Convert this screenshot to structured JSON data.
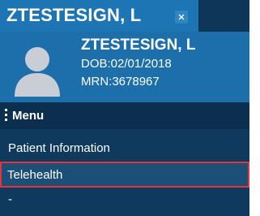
{
  "tab": {
    "title": "ZTESTESIGN, L",
    "close_icon": "close-icon"
  },
  "patient": {
    "name": "ZTESTESIGN, L",
    "dob": "DOB:02/01/2018",
    "mrn": "MRN:3678967",
    "avatar_icon": "person-silhouette-icon"
  },
  "menu": {
    "label": "Menu",
    "icon": "vertical-dots-icon",
    "items": [
      {
        "label": "Patient Information"
      },
      {
        "label": "Telehealth",
        "highlighted": true
      },
      {
        "label": "-"
      }
    ]
  },
  "colors": {
    "tab_bg": "#1d75b3",
    "header_bg": "#1c6fab",
    "panel_bg": "#0f3a5e",
    "menu_header_bg": "#0d2f4f",
    "highlight_border": "#e3343a"
  }
}
